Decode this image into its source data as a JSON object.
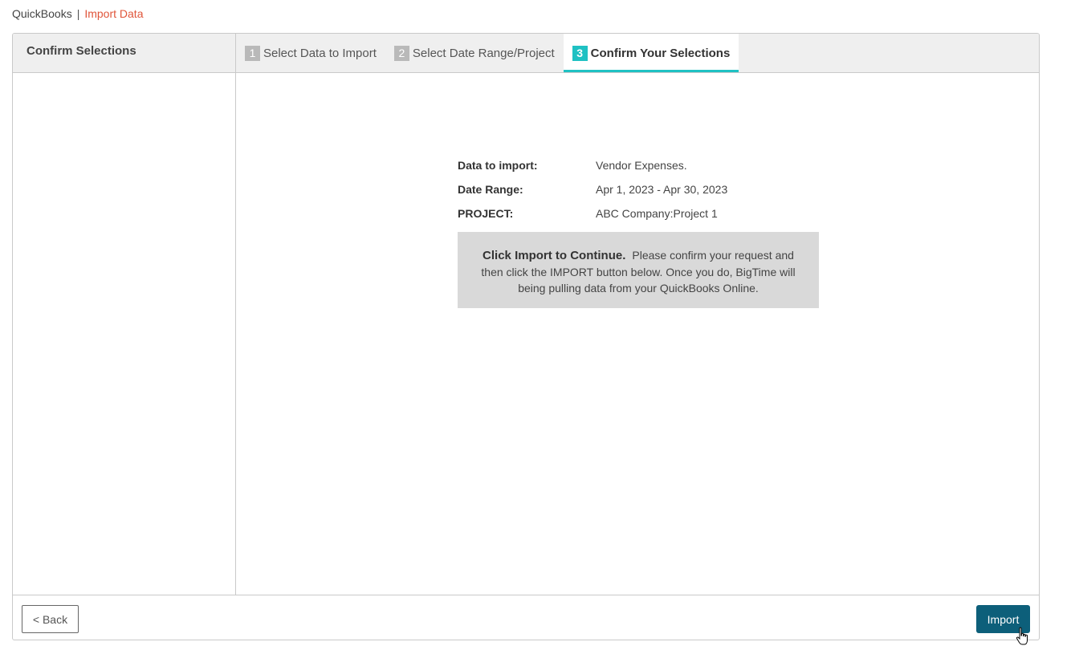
{
  "breadcrumb": {
    "root": "QuickBooks",
    "separator": "|",
    "current": "Import Data"
  },
  "sidebar": {
    "title": "Confirm Selections"
  },
  "tabs": [
    {
      "number": "1",
      "label": "Select Data to Import",
      "active": false
    },
    {
      "number": "2",
      "label": "Select Date Range/Project",
      "active": false
    },
    {
      "number": "3",
      "label": "Confirm Your Selections",
      "active": true
    }
  ],
  "summary": {
    "data_label": "Data to import:",
    "data_value": "Vendor Expenses.",
    "date_label": "Date Range:",
    "date_value": "Apr 1, 2023 - Apr 30, 2023",
    "project_label": "PROJECT:",
    "project_value": "ABC Company:Project 1"
  },
  "notice": {
    "heading": "Click Import to Continue.",
    "body": "Please confirm your request and then click the IMPORT button below. Once you do, BigTime will being pulling data from your QuickBooks Online."
  },
  "footer": {
    "back_label": "< Back",
    "import_label": "Import"
  },
  "colors": {
    "accent": "#1fc1c3",
    "primary_button": "#0d5f7a",
    "breadcrumb_current": "#e0553a",
    "notice_bg": "#d9d9d9"
  }
}
